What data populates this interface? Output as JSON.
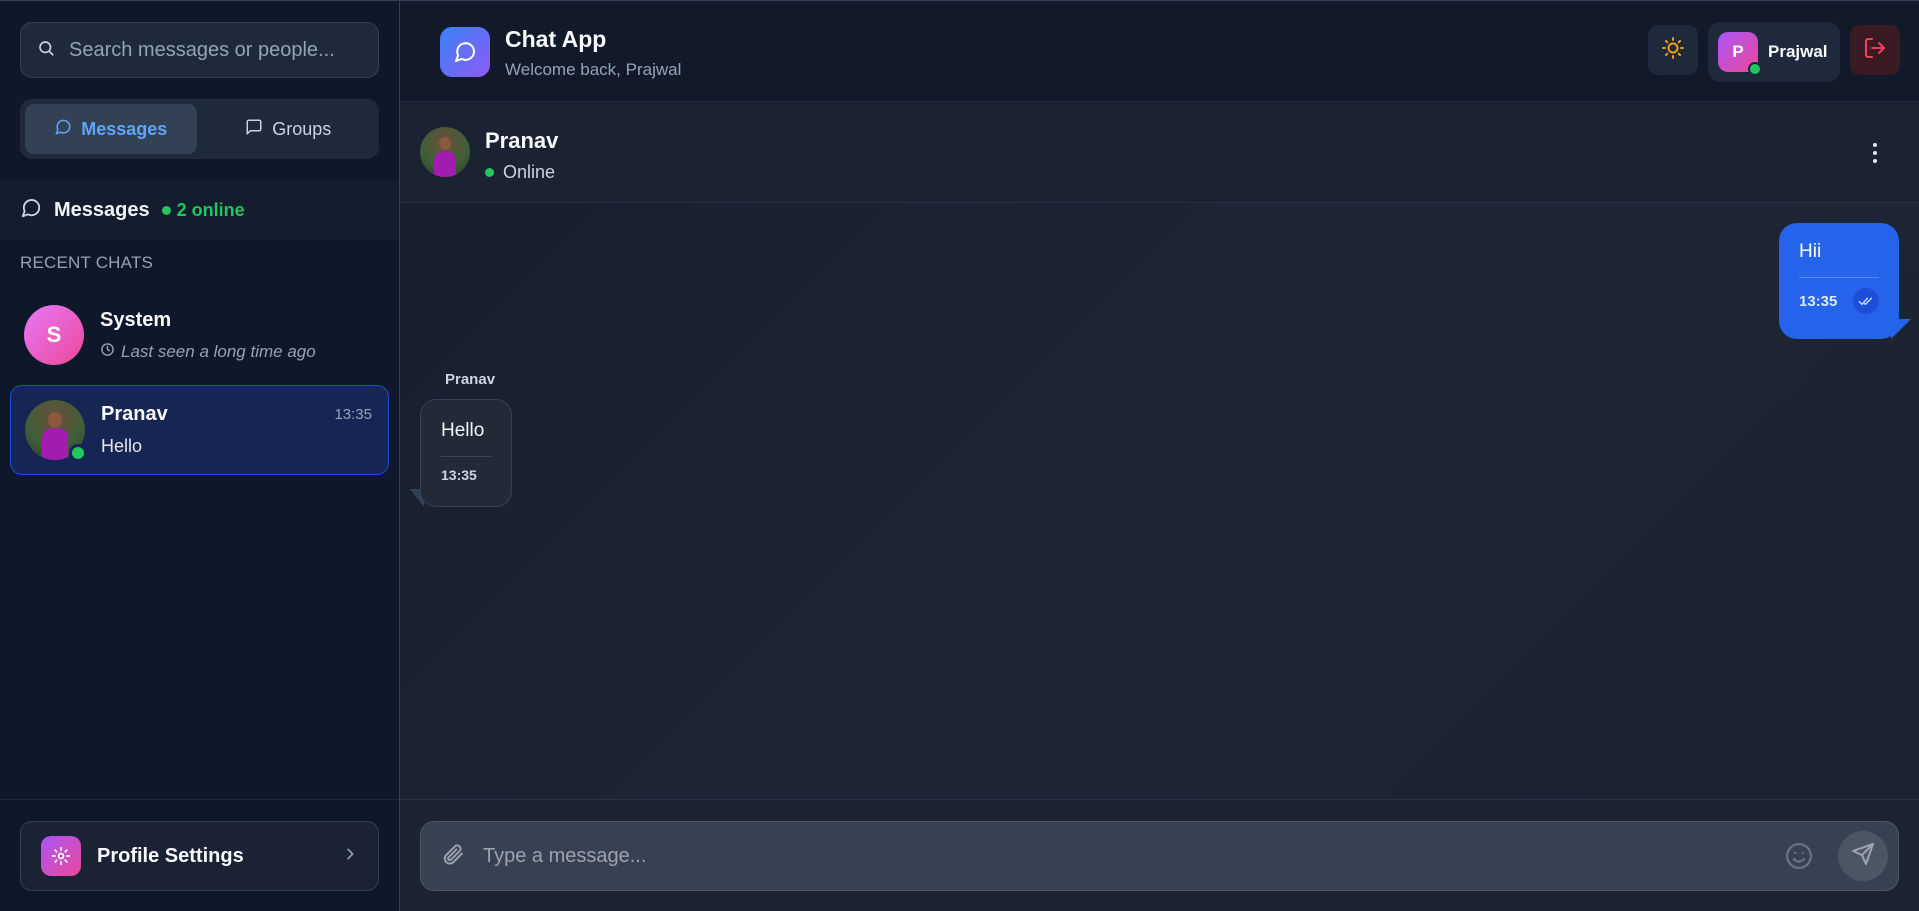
{
  "sidebar": {
    "search_placeholder": "Search messages or people...",
    "tabs": [
      {
        "label": "Messages",
        "active": true
      },
      {
        "label": "Groups",
        "active": false
      }
    ],
    "section_title": "Messages",
    "online_count": "2 online",
    "recent_label": "RECENT CHATS",
    "chats": [
      {
        "initial": "S",
        "name": "System",
        "subtitle": "Last seen a long time ago",
        "time": "",
        "online": false
      },
      {
        "initial": "",
        "name": "Pranav",
        "subtitle": "Hello",
        "time": "13:35",
        "online": true
      }
    ],
    "profile_settings_label": "Profile Settings"
  },
  "header": {
    "app_title": "Chat App",
    "welcome": "Welcome back, Prajwal",
    "user_initial": "P",
    "user_name": "Prajwal"
  },
  "conversation": {
    "name": "Pranav",
    "status": "Online",
    "messages": [
      {
        "direction": "out",
        "text": "Hii",
        "time": "13:35",
        "read": true
      },
      {
        "direction": "in",
        "sender": "Pranav",
        "text": "Hello",
        "time": "13:35"
      }
    ]
  },
  "composer": {
    "placeholder": "Type a message..."
  },
  "colors": {
    "accent": "#2563eb",
    "online": "#22c55e",
    "logout": "#f43f5e",
    "sun": "#f59e0b"
  },
  "icons": [
    "search-icon",
    "message-circle-icon",
    "message-square-icon",
    "clock-icon",
    "gear-icon",
    "chevron-right-icon",
    "sun-icon",
    "logout-icon",
    "more-vertical-icon",
    "double-check-icon",
    "paperclip-icon",
    "smile-icon",
    "send-icon"
  ]
}
